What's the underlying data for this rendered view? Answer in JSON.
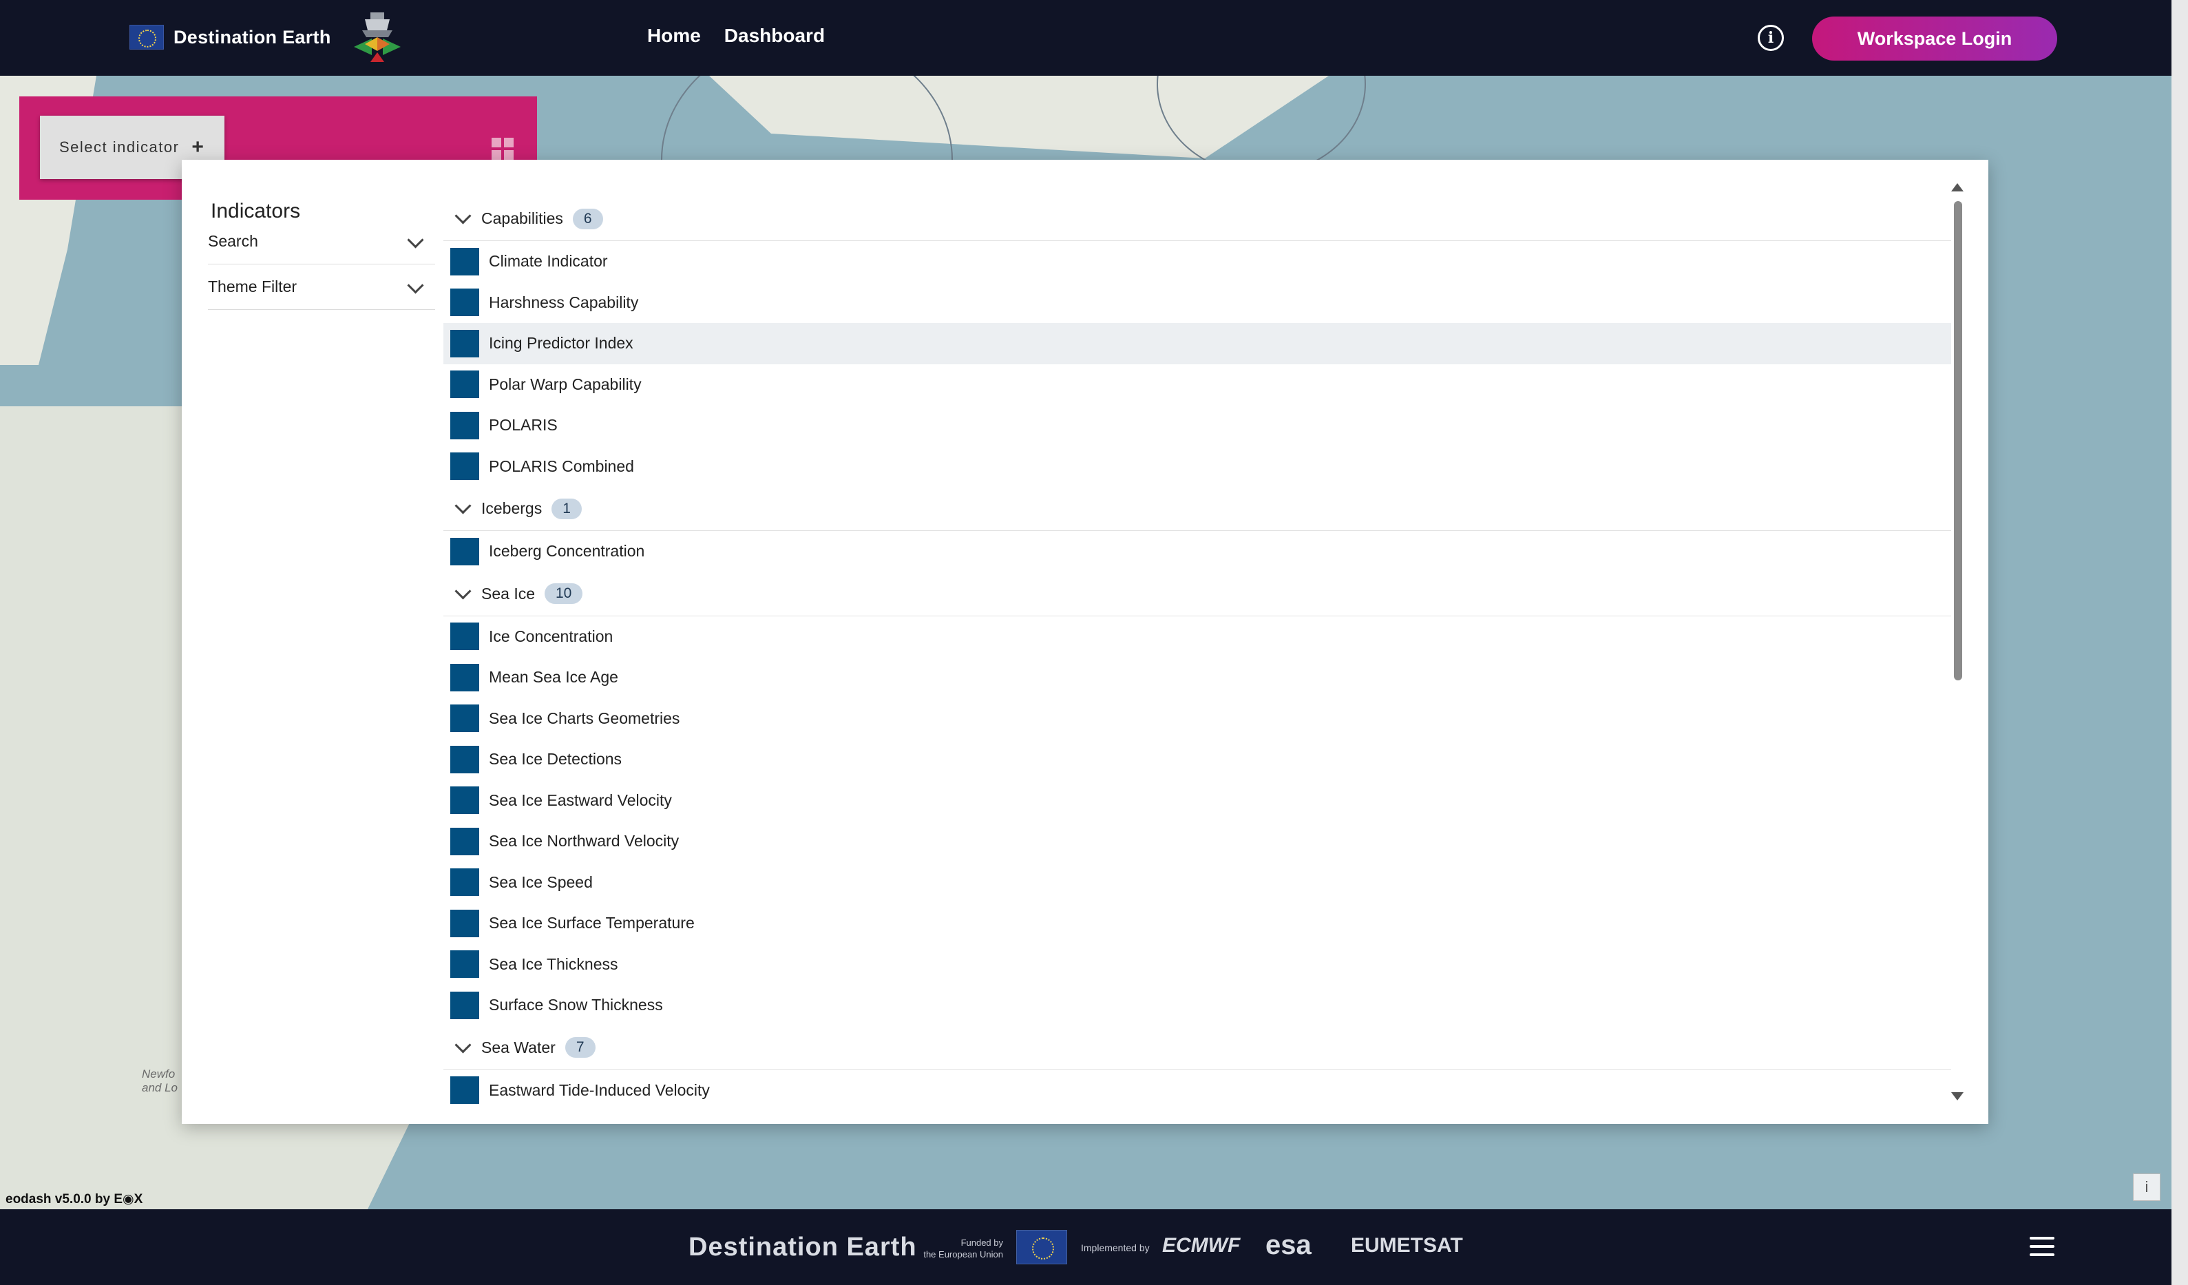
{
  "header": {
    "brand_title": "Destination Earth",
    "nav": [
      "Home",
      "Dashboard"
    ],
    "info_icon": "info-icon",
    "login_label": "Workspace Login"
  },
  "widget": {
    "select_indicator_label": "Select indicator",
    "select_indicator_icon": "plus-icon"
  },
  "modal": {
    "title": "Indicators",
    "filters": [
      "Search",
      "Theme Filter"
    ],
    "groups": [
      {
        "name": "Capabilities",
        "count": "6",
        "items": [
          "Climate Indicator",
          "Harshness Capability",
          "Icing Predictor Index",
          "Polar Warp Capability",
          "POLARIS",
          "POLARIS Combined"
        ]
      },
      {
        "name": "Icebergs",
        "count": "1",
        "items": [
          "Iceberg Concentration"
        ]
      },
      {
        "name": "Sea Ice",
        "count": "10",
        "items": [
          "Ice Concentration",
          "Mean Sea Ice Age",
          "Sea Ice Charts Geometries",
          "Sea Ice Detections",
          "Sea Ice Eastward Velocity",
          "Sea Ice Northward Velocity",
          "Sea Ice Speed",
          "Sea Ice Surface Temperature",
          "Sea Ice Thickness",
          "Surface Snow Thickness"
        ]
      },
      {
        "name": "Sea Water",
        "count": "7",
        "items": [
          "Eastward Tide-Induced Velocity"
        ]
      }
    ],
    "highlighted_item": "Icing Predictor Index",
    "swatch_color": "#034f80"
  },
  "map": {
    "label": "Newfo\nand Lo"
  },
  "footer": {
    "version": "eodash v5.0.0 by E◉X",
    "title": "Destination Earth",
    "funded_by": "Funded by\nthe European Union",
    "implemented_by": "Implemented by",
    "partners": [
      "ECMWF",
      "esa",
      "EUMETSAT"
    ]
  },
  "colors": {
    "topbar": "#101426",
    "accent": "#c81f6f",
    "login_gradient_start": "#c4187c",
    "login_gradient_end": "#9a2ab0"
  }
}
